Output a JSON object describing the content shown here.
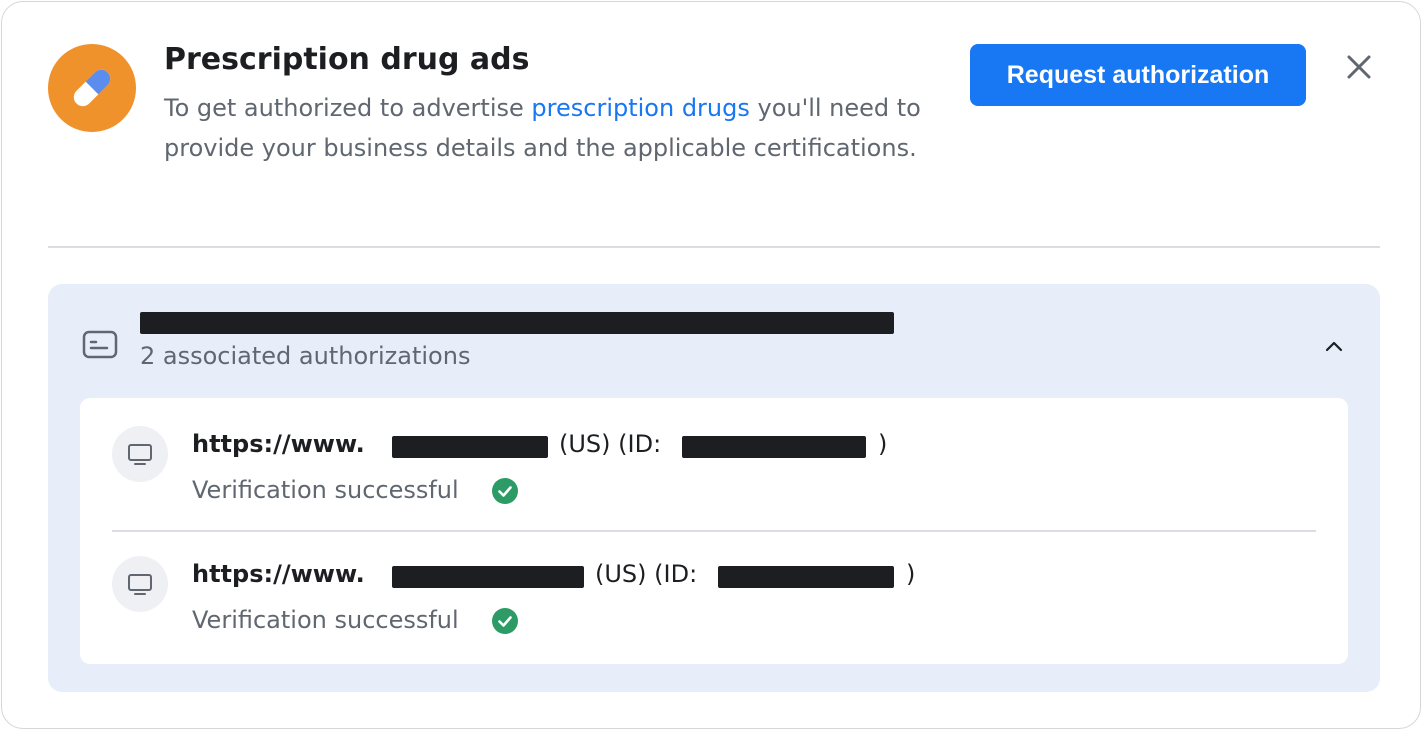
{
  "header": {
    "title": "Prescription drug ads",
    "description_before": "To get authorized to advertise ",
    "description_link": "prescription drugs",
    "description_after": " you'll need to provide your business details and the applicable certifications.",
    "request_button_label": "Request authorization",
    "icon": "pill-icon",
    "close_icon": "close-icon"
  },
  "colors": {
    "accent": "#1877f2",
    "icon_bg": "#f0922b",
    "section_bg": "#e7eefa",
    "success": "#31a24c"
  },
  "section": {
    "subtitle": "2 associated authorizations",
    "icon": "document-icon",
    "toggle_icon": "chevron-up-icon"
  },
  "authorizations": [
    {
      "url_prefix": "https://www.",
      "region": "(US) (ID:",
      "close_paren": ")",
      "status": "Verification successful",
      "icon": "monitor-icon",
      "status_icon": "check-circle-icon"
    },
    {
      "url_prefix": "https://www.",
      "region": "(US) (ID:",
      "close_paren": ")",
      "status": "Verification successful",
      "icon": "monitor-icon",
      "status_icon": "check-circle-icon"
    }
  ]
}
